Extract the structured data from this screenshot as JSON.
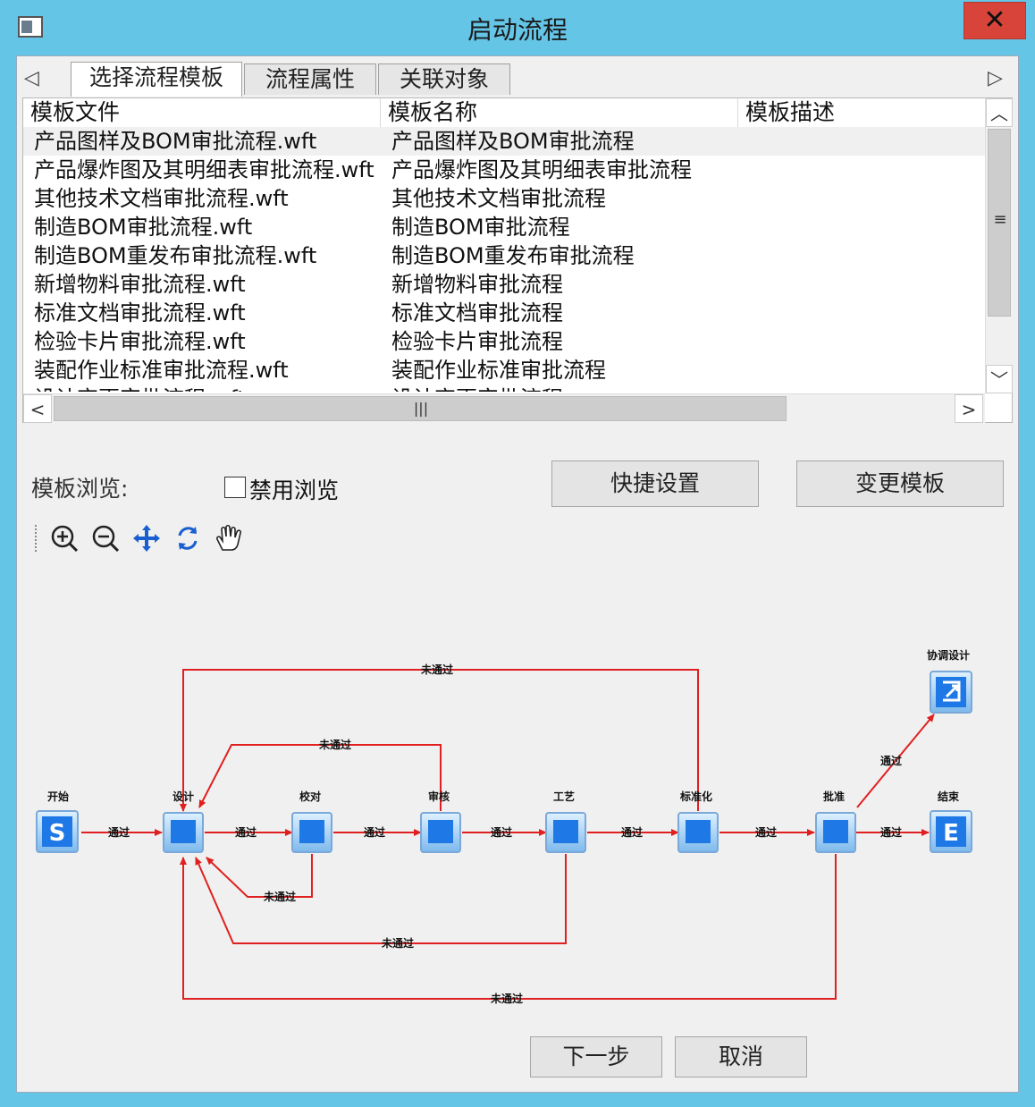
{
  "window": {
    "title": "启动流程",
    "close_label": "✕"
  },
  "tabs": [
    {
      "label": "选择流程模板",
      "active": true
    },
    {
      "label": "流程属性",
      "active": false
    },
    {
      "label": "关联对象",
      "active": false
    }
  ],
  "table": {
    "columns": [
      "模板文件",
      "模板名称",
      "模板描述"
    ],
    "rows": [
      {
        "file": "产品图样及BOM审批流程.wft",
        "name": "产品图样及BOM审批流程",
        "desc": ""
      },
      {
        "file": "产品爆炸图及其明细表审批流程.wft",
        "name": "产品爆炸图及其明细表审批流程",
        "desc": ""
      },
      {
        "file": "其他技术文档审批流程.wft",
        "name": "其他技术文档审批流程",
        "desc": ""
      },
      {
        "file": "制造BOM审批流程.wft",
        "name": "制造BOM审批流程",
        "desc": ""
      },
      {
        "file": "制造BOM重发布审批流程.wft",
        "name": "制造BOM重发布审批流程",
        "desc": ""
      },
      {
        "file": "新增物料审批流程.wft",
        "name": "新增物料审批流程",
        "desc": ""
      },
      {
        "file": "标准文档审批流程.wft",
        "name": "标准文档审批流程",
        "desc": ""
      },
      {
        "file": "检验卡片审批流程.wft",
        "name": "检验卡片审批流程",
        "desc": ""
      },
      {
        "file": "装配作业标准审批流程.wft",
        "name": "装配作业标准审批流程",
        "desc": ""
      },
      {
        "file": "设计变更审批流程.wft",
        "name": "设计变更审批流程",
        "desc": ""
      }
    ],
    "selected_row": 0
  },
  "preview": {
    "label": "模板浏览:",
    "disable_label": "禁用浏览",
    "disable_checked": false,
    "quick_settings_label": "快捷设置",
    "change_template_label": "变更模板"
  },
  "tools": [
    "zoom-in-icon",
    "zoom-out-icon",
    "move-icon",
    "refresh-icon",
    "hand-icon"
  ],
  "flow": {
    "nodes": {
      "start": "开始",
      "design": "设计",
      "check": "校对",
      "review": "审核",
      "process": "工艺",
      "standard": "标准化",
      "approve": "批准",
      "sub": "协调设计",
      "end": "结束"
    },
    "edges": {
      "pass": "通过",
      "fail": "未通过"
    }
  },
  "footer": {
    "next_label": "下一步",
    "cancel_label": "取消"
  },
  "colors": {
    "flow_line": "#e02020",
    "node_blue": "#1e78e6",
    "title_bar": "#65c5e7",
    "close": "#d9443a"
  }
}
